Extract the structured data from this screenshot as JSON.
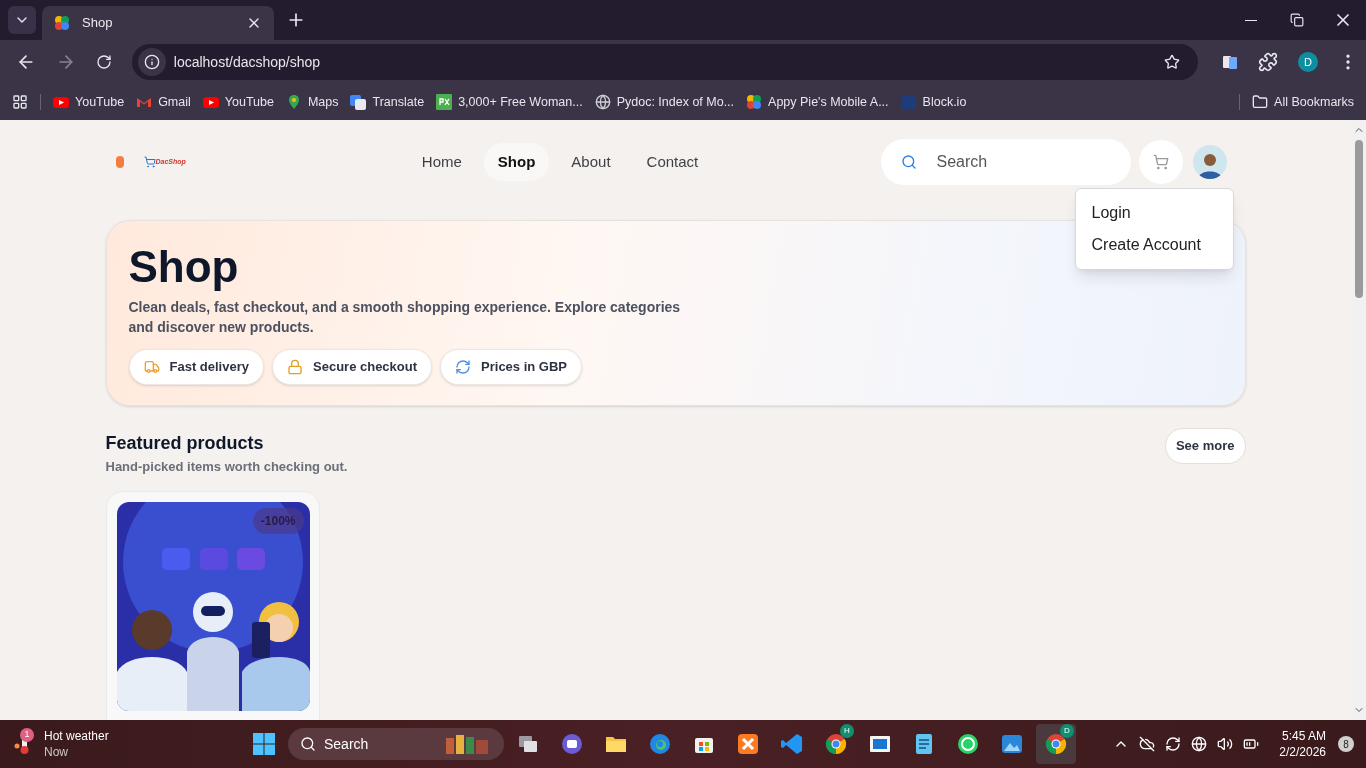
{
  "browser": {
    "tab_title": "Shop",
    "url": "localhost/dacshop/shop",
    "profile_initial": "D",
    "bookmarks": [
      {
        "kind": "youtube",
        "label": "YouTube"
      },
      {
        "kind": "gmail",
        "label": "Gmail"
      },
      {
        "kind": "youtube",
        "label": "YouTube"
      },
      {
        "kind": "maps",
        "label": "Maps"
      },
      {
        "kind": "translate",
        "label": "Translate"
      },
      {
        "kind": "px",
        "label": "3,000+ Free Woman..."
      },
      {
        "kind": "globe",
        "label": "Pydoc: Index of Mo..."
      },
      {
        "kind": "appypie",
        "label": "Appy Pie's Mobile A..."
      },
      {
        "kind": "blockio",
        "label": "Block.io"
      }
    ],
    "all_bookmarks": "All Bookmarks"
  },
  "page": {
    "logo_text": "DacShop",
    "nav": [
      {
        "label": "Home",
        "selected": false
      },
      {
        "label": "Shop",
        "selected": true
      },
      {
        "label": "About",
        "selected": false
      },
      {
        "label": "Contact",
        "selected": false
      }
    ],
    "search_placeholder": "Search",
    "account_menu": [
      "Login",
      "Create Account"
    ],
    "hero": {
      "title": "Shop",
      "text": "Clean deals, fast checkout, and a smooth shopping experience. Explore categories and discover new products.",
      "chips": [
        {
          "kind": "truck",
          "label": "Fast delivery"
        },
        {
          "kind": "lock",
          "label": "Secure checkout"
        },
        {
          "kind": "refresh",
          "label": "Prices in GBP"
        }
      ]
    },
    "featured": {
      "title": "Featured products",
      "subtitle": "Hand-picked items worth checking out.",
      "see_more": "See more",
      "products": [
        {
          "kind": "picture",
          "discount": "-100%"
        }
      ]
    }
  },
  "taskbar": {
    "weather": {
      "badge": "1",
      "title": "Hot weather",
      "subtitle": "Now"
    },
    "search_placeholder": "Search",
    "apps": [
      {
        "kind": "taskview",
        "selected": false
      },
      {
        "kind": "chat",
        "selected": false
      },
      {
        "kind": "files",
        "selected": false
      },
      {
        "kind": "edge",
        "selected": false
      },
      {
        "kind": "store",
        "selected": false
      },
      {
        "kind": "xampp",
        "selected": false
      },
      {
        "kind": "vscode",
        "selected": false
      },
      {
        "kind": "chrome",
        "badge": "H",
        "selected": false
      },
      {
        "kind": "slides",
        "selected": false
      },
      {
        "kind": "notepad",
        "selected": false
      },
      {
        "kind": "whatsapp",
        "selected": false
      },
      {
        "kind": "photos",
        "selected": false
      },
      {
        "kind": "chrome",
        "badge": "D",
        "selected": true
      }
    ],
    "time": "5:45 AM",
    "date": "2/2/2026",
    "notifications": "8"
  }
}
